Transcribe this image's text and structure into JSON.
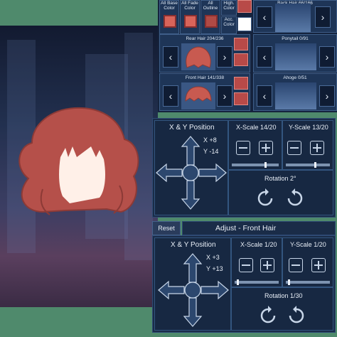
{
  "top": {
    "color_buttons": [
      "All Base Color",
      "All Fade Color",
      "All Outline",
      "High. Color",
      "Acc. Color"
    ],
    "back_hair_title": "Back Hair 66/166",
    "rear_hair_title": "Rear Hair 204/236",
    "ponytail_title": "Ponytail 0/91",
    "front_hair_title": "Front Hair 141/338",
    "ahoge_title": "Ahoge 0/51"
  },
  "panel_a": {
    "xy_label": "X & Y Position",
    "x_val": "X +8",
    "y_val": "Y -14",
    "xscale_label": "X-Scale 14/20",
    "yscale_label": "Y-Scale 13/20",
    "xscale": 0.7,
    "yscale": 0.65,
    "rotation_label": "Rotation 2°"
  },
  "panel_b": {
    "reset_label": "Reset",
    "header": "Adjust - Front Hair",
    "xy_label": "X & Y Position",
    "x_val": "X +3",
    "y_val": "Y +13",
    "xscale_label": "X-Scale 1/20",
    "yscale_label": "Y-Scale 1/20",
    "xscale": 0.05,
    "yscale": 0.05,
    "rotation_label": "Rotation 1/30"
  },
  "colors": {
    "hair": "#b5504a",
    "hair_dark": "#8c3a36",
    "face": "#fff0e8",
    "panel": "#1a2c48",
    "accent": "#4f8a6c"
  },
  "icons": [
    "left-arrow-icon",
    "right-arrow-icon",
    "plus-icon",
    "minus-icon",
    "rotate-ccw-icon",
    "rotate-cw-icon",
    "four-way-arrows-icon"
  ]
}
